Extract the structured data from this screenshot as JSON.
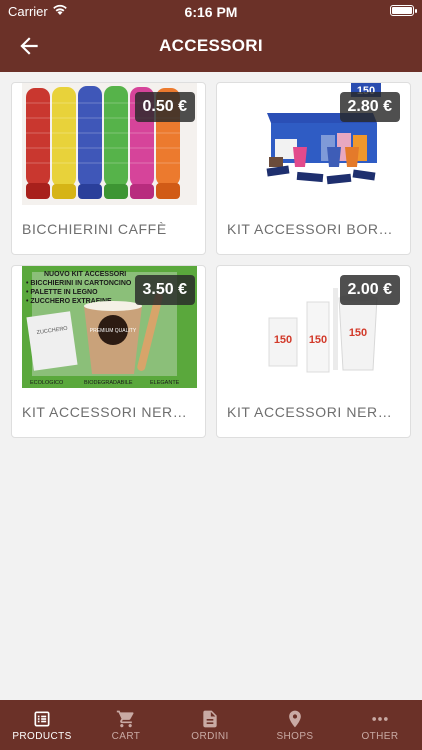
{
  "status": {
    "carrier": "Carrier",
    "time": "6:16 PM"
  },
  "header": {
    "title": "ACCESSORI",
    "back_icon": "back-arrow-icon"
  },
  "products": [
    {
      "name": "BICCHIERINI CAFFÈ",
      "price": "0.50 €"
    },
    {
      "name": "KIT ACCESSORI BORBONE",
      "price": "2.80 €",
      "image_label": "150"
    },
    {
      "name": "KIT ACCESSORI NERO NERO",
      "price": "3.50 €",
      "image_lines": [
        "NUOVO KIT ACCESSORI",
        "• BICCHIERINI IN CARTONCINO",
        "• PALETTE IN LEGNO",
        "• ZUCCHERO EXTRAFINE"
      ],
      "image_footer": [
        "ECOLOGICO",
        "BIODEGRADABILE",
        "ELEGANTE"
      ],
      "image_badge": "ZUCCHERO",
      "cup_text": "PREMIUM QUALITY"
    },
    {
      "name": "KIT ACCESSORI NERO NERO",
      "price": "2.00 €",
      "image_label": "150"
    }
  ],
  "tabs": [
    {
      "label": "PRODUCTS",
      "icon": "products-icon",
      "active": true
    },
    {
      "label": "CART",
      "icon": "cart-icon",
      "active": false
    },
    {
      "label": "ORDINI",
      "icon": "document-icon",
      "active": false
    },
    {
      "label": "SHOPS",
      "icon": "location-pin-icon",
      "active": false
    },
    {
      "label": "OTHER",
      "icon": "more-icon",
      "active": false
    }
  ],
  "colors": {
    "brand": "#6b3128",
    "price_badge": "#282828",
    "background": "#f2f2f2"
  }
}
